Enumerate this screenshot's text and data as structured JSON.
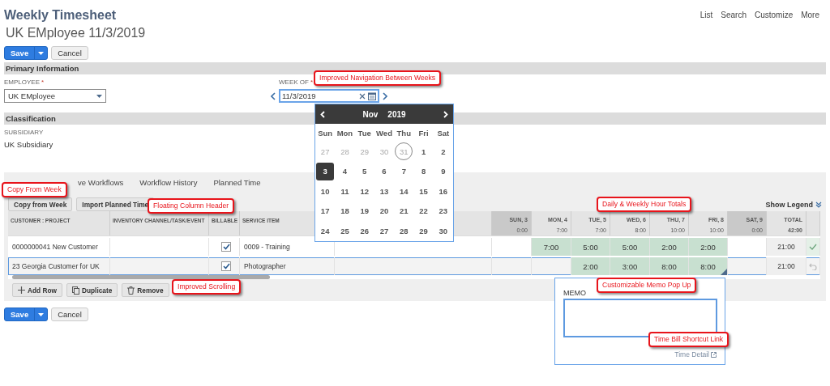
{
  "header": {
    "title": "Weekly Timesheet",
    "subtitle": "UK EMployee 11/3/2019",
    "nav": [
      "List",
      "Search",
      "Customize",
      "More"
    ]
  },
  "top_buttons": {
    "save": "Save",
    "cancel": "Cancel"
  },
  "primary": {
    "title": "Primary Information",
    "employee": {
      "label": "EMPLOYEE",
      "mark": "*",
      "value": "UK EMployee"
    },
    "week_of": {
      "label": "WEEK OF",
      "mark": "*",
      "value": "11/3/2019"
    }
  },
  "classification": {
    "title": "Classification",
    "subsidiary": {
      "label": "SUBSIDIARY",
      "value": "UK Subsidiary"
    }
  },
  "tabs": [
    {
      "label": "ve Workflows",
      "selected": false
    },
    {
      "label": "Workflow History",
      "selected": false
    },
    {
      "label": "Planned Time",
      "selected": false
    }
  ],
  "subtab_buttons": [
    "Copy from Week",
    "Import Planned Time"
  ],
  "show_legend": "Show Legend",
  "table": {
    "columns": [
      "CUSTOMER : PROJECT",
      "INVENTORY CHANNEL/TASK/EVENT",
      "BILLABLE",
      "SERVICE ITEM"
    ],
    "days": [
      {
        "label": "SUN, 3",
        "total": "0:00",
        "weekend": true
      },
      {
        "label": "MON, 4",
        "total": "7:00",
        "weekend": false
      },
      {
        "label": "TUE, 5",
        "total": "7:00",
        "weekend": false
      },
      {
        "label": "WED, 6",
        "total": "8:00",
        "weekend": false
      },
      {
        "label": "THU, 7",
        "total": "10:00",
        "weekend": false
      },
      {
        "label": "FRI, 8",
        "total": "10:00",
        "weekend": false
      },
      {
        "label": "SAT, 9",
        "total": "0:00",
        "weekend": true
      }
    ],
    "total": {
      "label": "TOTAL",
      "value": "42:00"
    },
    "rows": [
      {
        "customer": "0000000041 New Customer",
        "billable": true,
        "service_item": "0009 - Training",
        "hours": [
          {
            "filled": false
          },
          {
            "filled": true,
            "value": "7:00"
          },
          {
            "filled": true,
            "value": "5:00"
          },
          {
            "filled": true,
            "value": "5:00"
          },
          {
            "filled": true,
            "value": "2:00"
          },
          {
            "filled": true,
            "value": "2:00"
          },
          {
            "filled": false
          }
        ],
        "total": "21:00",
        "memo": false,
        "selected": false
      },
      {
        "customer": "23 Georgia Customer for UK",
        "billable": true,
        "service_item": "Photographer",
        "hours": [
          {
            "filled": false
          },
          {
            "filled": false
          },
          {
            "filled": true,
            "value": "2:00"
          },
          {
            "filled": true,
            "value": "3:00"
          },
          {
            "filled": true,
            "value": "8:00"
          },
          {
            "filled": true,
            "value": "8:00"
          },
          {
            "filled": false
          }
        ],
        "total": "21:00",
        "memo": true,
        "selected": true
      }
    ]
  },
  "row_buttons": [
    "Add Row",
    "Duplicate",
    "Remove"
  ],
  "bottom_buttons": {
    "save": "Save",
    "cancel": "Cancel"
  },
  "calendar": {
    "month": "Nov",
    "year": "2019",
    "weekdays": [
      "Sun",
      "Mon",
      "Tue",
      "Wed",
      "Thu",
      "Fri",
      "Sat"
    ],
    "weeks": [
      [
        {
          "day": "27",
          "outside": true,
          "today": false,
          "selected": false
        },
        {
          "day": "28",
          "outside": true,
          "today": false,
          "selected": false
        },
        {
          "day": "29",
          "outside": true,
          "today": false,
          "selected": false
        },
        {
          "day": "30",
          "outside": true,
          "today": false,
          "selected": false
        },
        {
          "day": "31",
          "outside": true,
          "today": true,
          "selected": false
        },
        {
          "day": "1",
          "outside": false,
          "today": false,
          "selected": false
        },
        {
          "day": "2",
          "outside": false,
          "today": false,
          "selected": false
        }
      ],
      [
        {
          "day": "3",
          "outside": false,
          "today": false,
          "selected": true
        },
        {
          "day": "4",
          "outside": false,
          "today": false,
          "selected": false
        },
        {
          "day": "5",
          "outside": false,
          "today": false,
          "selected": false
        },
        {
          "day": "6",
          "outside": false,
          "today": false,
          "selected": false
        },
        {
          "day": "7",
          "outside": false,
          "today": false,
          "selected": false
        },
        {
          "day": "8",
          "outside": false,
          "today": false,
          "selected": false
        },
        {
          "day": "9",
          "outside": false,
          "today": false,
          "selected": false
        }
      ],
      [
        {
          "day": "10",
          "outside": false,
          "today": false,
          "selected": false
        },
        {
          "day": "11",
          "outside": false,
          "today": false,
          "selected": false
        },
        {
          "day": "12",
          "outside": false,
          "today": false,
          "selected": false
        },
        {
          "day": "13",
          "outside": false,
          "today": false,
          "selected": false
        },
        {
          "day": "14",
          "outside": false,
          "today": false,
          "selected": false
        },
        {
          "day": "15",
          "outside": false,
          "today": false,
          "selected": false
        },
        {
          "day": "16",
          "outside": false,
          "today": false,
          "selected": false
        }
      ],
      [
        {
          "day": "17",
          "outside": false,
          "today": false,
          "selected": false
        },
        {
          "day": "18",
          "outside": false,
          "today": false,
          "selected": false
        },
        {
          "day": "19",
          "outside": false,
          "today": false,
          "selected": false
        },
        {
          "day": "20",
          "outside": false,
          "today": false,
          "selected": false
        },
        {
          "day": "21",
          "outside": false,
          "today": false,
          "selected": false
        },
        {
          "day": "22",
          "outside": false,
          "today": false,
          "selected": false
        },
        {
          "day": "23",
          "outside": false,
          "today": false,
          "selected": false
        }
      ],
      [
        {
          "day": "24",
          "outside": false,
          "today": false,
          "selected": false
        },
        {
          "day": "25",
          "outside": false,
          "today": false,
          "selected": false
        },
        {
          "day": "26",
          "outside": false,
          "today": false,
          "selected": false
        },
        {
          "day": "27",
          "outside": false,
          "today": false,
          "selected": false
        },
        {
          "day": "28",
          "outside": false,
          "today": false,
          "selected": false
        },
        {
          "day": "29",
          "outside": false,
          "today": false,
          "selected": false
        },
        {
          "day": "30",
          "outside": false,
          "today": false,
          "selected": false
        }
      ]
    ]
  },
  "memo": {
    "label": "MEMO",
    "link": "Time Detail"
  },
  "annotations": [
    {
      "text": "Improved Navigation Between Weeks"
    },
    {
      "text": "Copy From Week"
    },
    {
      "text": "Floating Column Header"
    },
    {
      "text": "Daily & Weekly Hour Totals"
    },
    {
      "text": "Improved Scrolling"
    },
    {
      "text": "Customizable Memo Pop Up"
    },
    {
      "text": "Time Bill Shortcut Link"
    }
  ]
}
